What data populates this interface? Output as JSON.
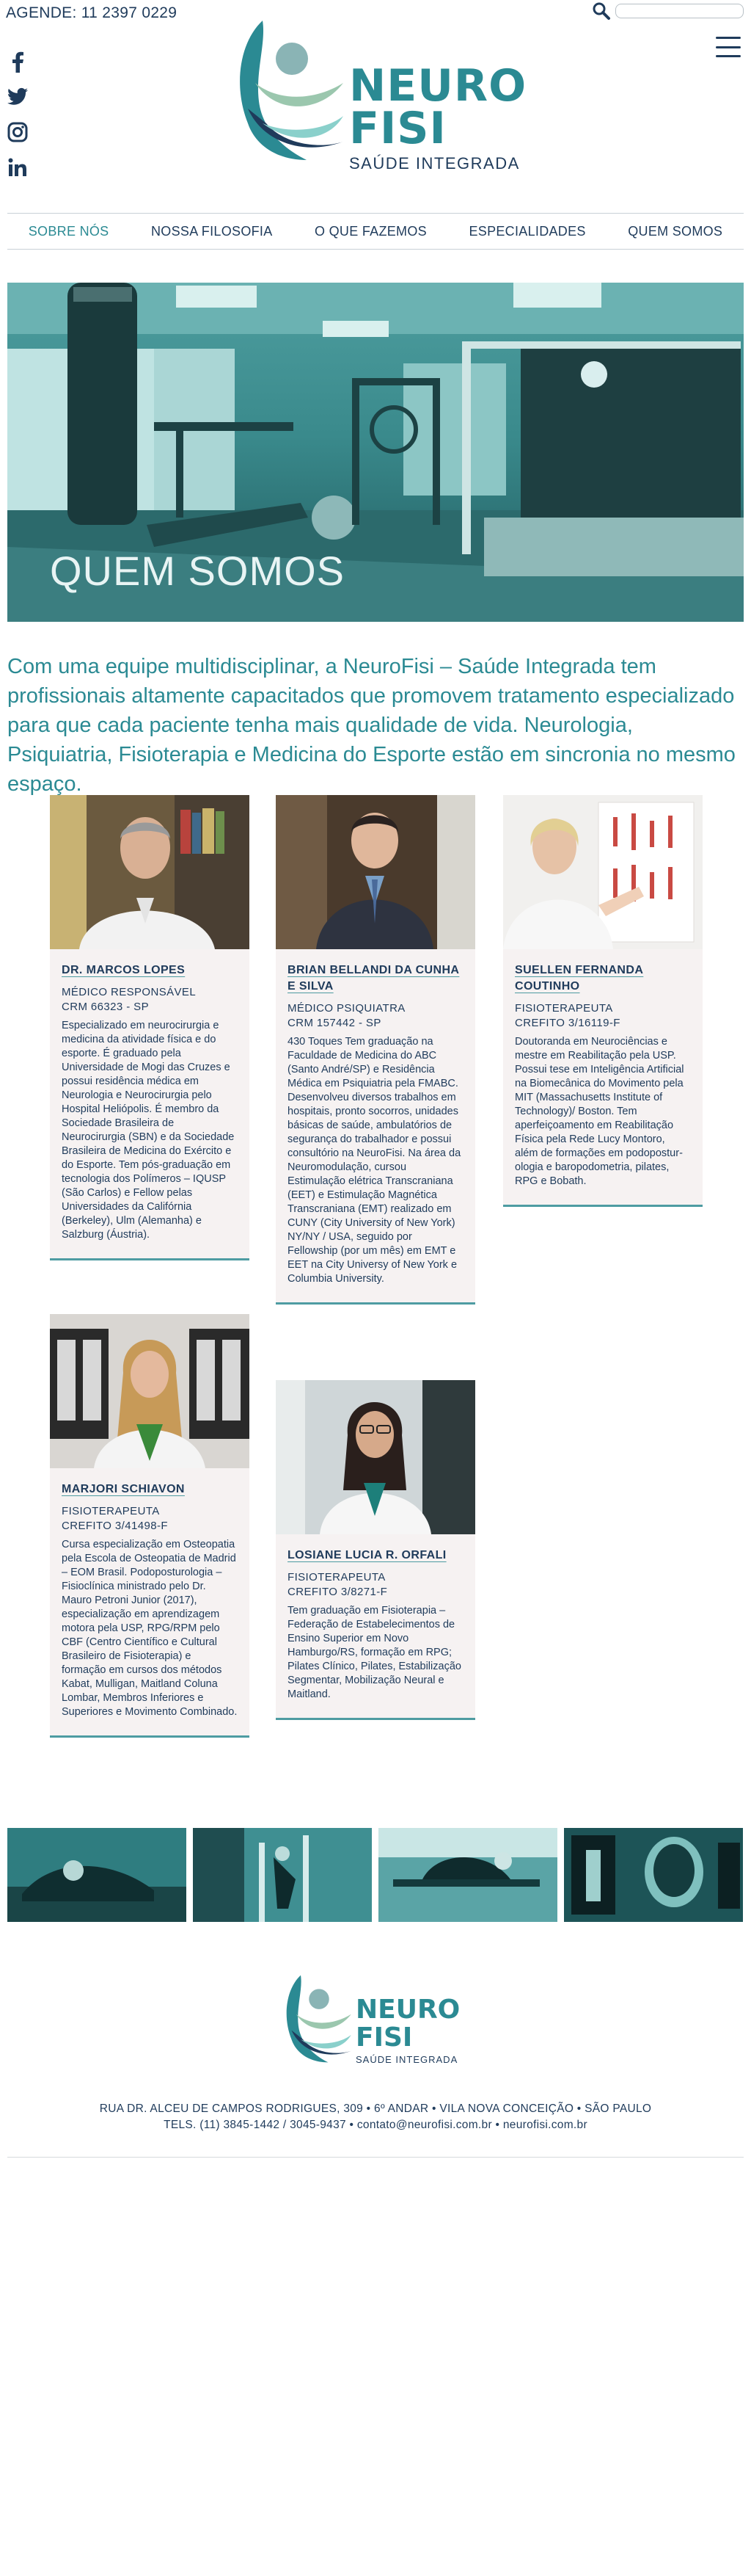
{
  "header": {
    "phone": "AGENDE: 11 2397 0229",
    "search": {
      "placeholder": ""
    },
    "logo": {
      "word1": "NEURO",
      "word2": "FISI",
      "tagline": "SAÚDE INTEGRADA"
    },
    "social": [
      "facebook-icon",
      "twitter-icon",
      "instagram-icon",
      "linkedin-icon"
    ]
  },
  "nav": {
    "items": [
      {
        "label": "SOBRE NÓS",
        "active": true
      },
      {
        "label": "NOSSA FILOSOFIA"
      },
      {
        "label": "O QUE FAZEMOS"
      },
      {
        "label": "ESPECIALIDADES"
      },
      {
        "label": "QUEM SOMOS"
      }
    ]
  },
  "hero": {
    "title": "QUEM SOMOS"
  },
  "intro": "Com uma equipe multidisciplinar, a NeuroFisi – Saúde Integrada tem profissionais altamente capacitados que promovem tratamento especializado para que cada paciente tenha mais qualidade de vida. Neurologia, Psiquiatria, Fisioterapia e Medicina do Esporte estão em sincronia no mesmo espaço.",
  "team": [
    {
      "name": "DR. MARCOS LOPES",
      "role": "MÉDICO RESPONSÁVEL",
      "reg": "CRM 66323 - SP",
      "bio": "Especializado em neurocirurgia e medicina da atividade física e do esporte. É graduado pela Universidade de Mogi das Cruzes e possui residência médica em Neurologia e Neurocirurgia pelo Hospital Heliópolis. É membro da Sociedade Brasileira de Neurocirurgia (SBN) e da Sociedade Brasileira de Medicina do Exército e do Esporte. Tem pós-graduação em tecnologia dos Polímeros – IQUSP (São Carlos) e Fellow pelas Universidades da Califórnia (Berkeley), Ulm (Alemanha) e Salzburg (Áustria)."
    },
    {
      "name": "BRIAN BELLANDI DA CUNHA E SILVA",
      "role": "MÉDICO PSIQUIATRA",
      "reg": "CRM 157442 - SP",
      "bio": "430 Toques Tem graduação na Faculdade de Medicina do ABC (Santo André/SP) e Residência Médica em Psiquiatria pela FMABC. Desenvolveu diversos trabalhos em hospitais, pronto socorros, unidades básicas de saúde, ambulatórios de segurança do trabalhador e possui consultório na NeuroFisi. Na área da Neuromodulação, cursou Estimulação elétrica Transcraniana (EET) e Estimulação Magnética Transcraniana (EMT) realizado em CUNY (City University of New York) NY/NY / USA, seguido por Fellowship (por um mês) em EMT e EET na City Universy of New York e Columbia University."
    },
    {
      "name": "SUELLEN FERNANDA COUTINHO",
      "role": "FISIOTERAPEUTA",
      "reg": "CREFITO 3/16119-F",
      "bio": "Doutoranda em Neurociências e mestre em Reabilitação pela USP. Possui tese em Inteligência Artificial na Biomecânica do Movimento pela MIT (Massachusetts Institute of Technology)/ Boston. Tem aperfeiçoamento em Reabilitação Física pela Rede Lucy Montoro, além de formações em podopostur­ologia e baropodometria, pilates, RPG e Bobath."
    },
    {
      "name": "MARJORI SCHIAVON",
      "role": "FISIOTERAPEUTA",
      "reg": "CREFITO 3/41498-F",
      "bio": "Cursa especialização em Osteopatia pela Escola de Osteopatia de Madrid – EOM Brasil. Podoposturologia – Fisioclínica ministrado pelo Dr. Mauro Petroni Junior (2017), especialização em aprendizagem motora pela USP, RPG/RPM pelo CBF (Centro Científico e Cultural Brasileiro de Fisioterapia) e formação em cursos dos métodos Kabat, Mulligan, Maitland Coluna Lombar, Membros Inferiores e Superiores e Movimento Combinado."
    },
    {
      "name": "LOSIANE LUCIA R. ORFALI",
      "role": "FISIOTERAPEUTA",
      "reg": "CREFITO 3/8271-F",
      "bio": "Tem graduação em Fisioterapia – Federação de Estabelecimentos de Ensino Superior em Novo Hamburgo/RS, formação em RPG; Pilates Clínico, Pilates, Estabilização Segmentar, Mobilização Neural e Maitland."
    }
  ],
  "footer": {
    "logo": {
      "word1": "NEURO",
      "word2": "FISI",
      "tagline": "SAÚDE INTEGRADA"
    },
    "address": "RUA DR. ALCEU DE CAMPOS RODRIGUES, 309 • 6º ANDAR • VILA NOVA CONCEIÇÃO • SÃO PAULO",
    "contact": "TELS. (11) 3845-1442 / 3045-9437 • contato@neurofisi.com.br • neurofisi.com.br"
  },
  "colors": {
    "teal": "#2b8a93",
    "navy": "#1f3b5b",
    "card_bg": "#f6f2f2"
  }
}
